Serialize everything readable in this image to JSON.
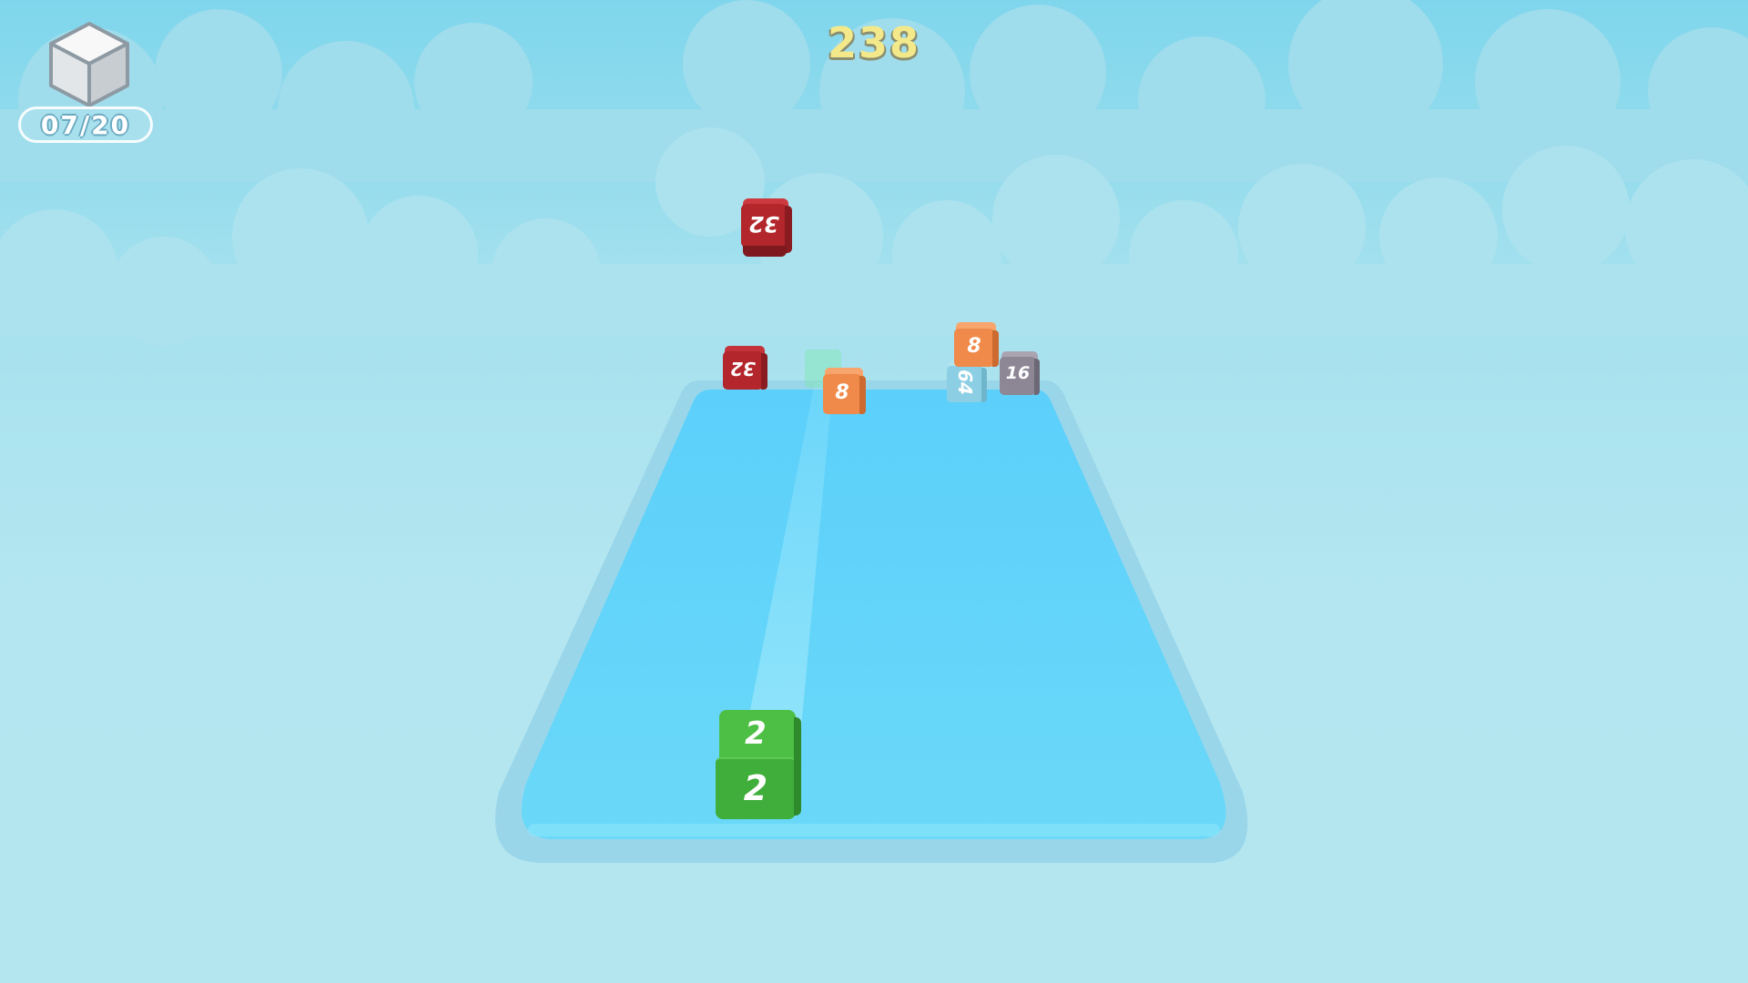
{
  "hud": {
    "cube_counter": "07/20",
    "score": "238"
  },
  "cubes": [
    {
      "id": "player",
      "value": "2",
      "color": "#3fae3a"
    },
    {
      "id": "red-top",
      "value": "32",
      "color": "#b2262c"
    },
    {
      "id": "red-left",
      "value": "32",
      "color": "#b2262c"
    },
    {
      "id": "orange-center",
      "value": "8",
      "color": "#f08a4a"
    },
    {
      "id": "orange-right",
      "value": "8",
      "color": "#f08a4a"
    },
    {
      "id": "blue-right",
      "value": "64",
      "color": "#8ccfe4"
    },
    {
      "id": "gray-right",
      "value": "16",
      "color": "#8d8795"
    }
  ],
  "colors": {
    "sky": "#a6e1ee",
    "lane": "#62d3fa",
    "lane_border": "#9ad6ea",
    "score": "#f3e98a"
  }
}
